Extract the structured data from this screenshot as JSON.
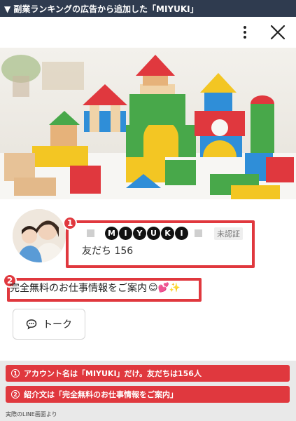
{
  "banner": {
    "title": "▼ 副業ランキングの広告から追加した「MIYUKI」"
  },
  "toolbar": {
    "menu_icon": "kebab-menu-icon",
    "close_icon": "close-icon"
  },
  "hero": {
    "image": "colorful-toy-building-blocks"
  },
  "profile": {
    "avatar": "mother-and-child-photo",
    "name_letters": [
      "M",
      "I",
      "Y",
      "U",
      "K",
      "I"
    ],
    "unverified_label": "未認証",
    "friends_text": "友だち 156",
    "intro_text": "完全無料のお仕事情報をご案内",
    "intro_emojis": "😊💕✨",
    "talk_label": "トーク",
    "marker_1": "1",
    "marker_2": "2"
  },
  "notes": {
    "items": [
      {
        "num": "1",
        "text": "アカウント名は「MIYUKI」だけ。友だちは156人"
      },
      {
        "num": "2",
        "text": "紹介文は「完全無料のお仕事情報をご案内」"
      }
    ],
    "caption": "実際のLINE画面より"
  },
  "colors": {
    "accent": "#e0383e",
    "banner_bg": "#2f3b4f"
  }
}
